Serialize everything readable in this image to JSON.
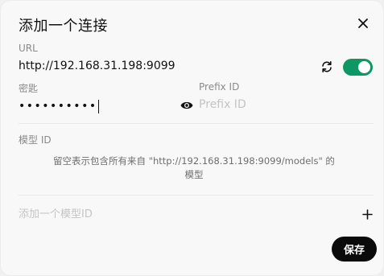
{
  "dialog": {
    "title": "添加一个连接",
    "close_icon": "close-icon"
  },
  "url": {
    "label": "URL",
    "value": "http://192.168.31.198:9099",
    "refresh_icon": "refresh-icon",
    "enabled": true
  },
  "key": {
    "label": "密匙",
    "masked_value": "••••••••••",
    "visibility_icon": "eye-icon"
  },
  "prefix": {
    "label": "Prefix ID",
    "placeholder": "Prefix ID",
    "value": ""
  },
  "models": {
    "label": "模型 ID",
    "hint": "留空表示包含所有来自 \"http://192.168.31.198:9099/models\" 的模型",
    "add_placeholder": "添加一个模型ID",
    "add_icon": "plus-icon"
  },
  "footer": {
    "save_label": "保存"
  },
  "colors": {
    "toggle_on": "#0d9863",
    "save_button": "#0a0a0a",
    "label": "#8a8a8a",
    "placeholder": "#c4c4c4"
  }
}
